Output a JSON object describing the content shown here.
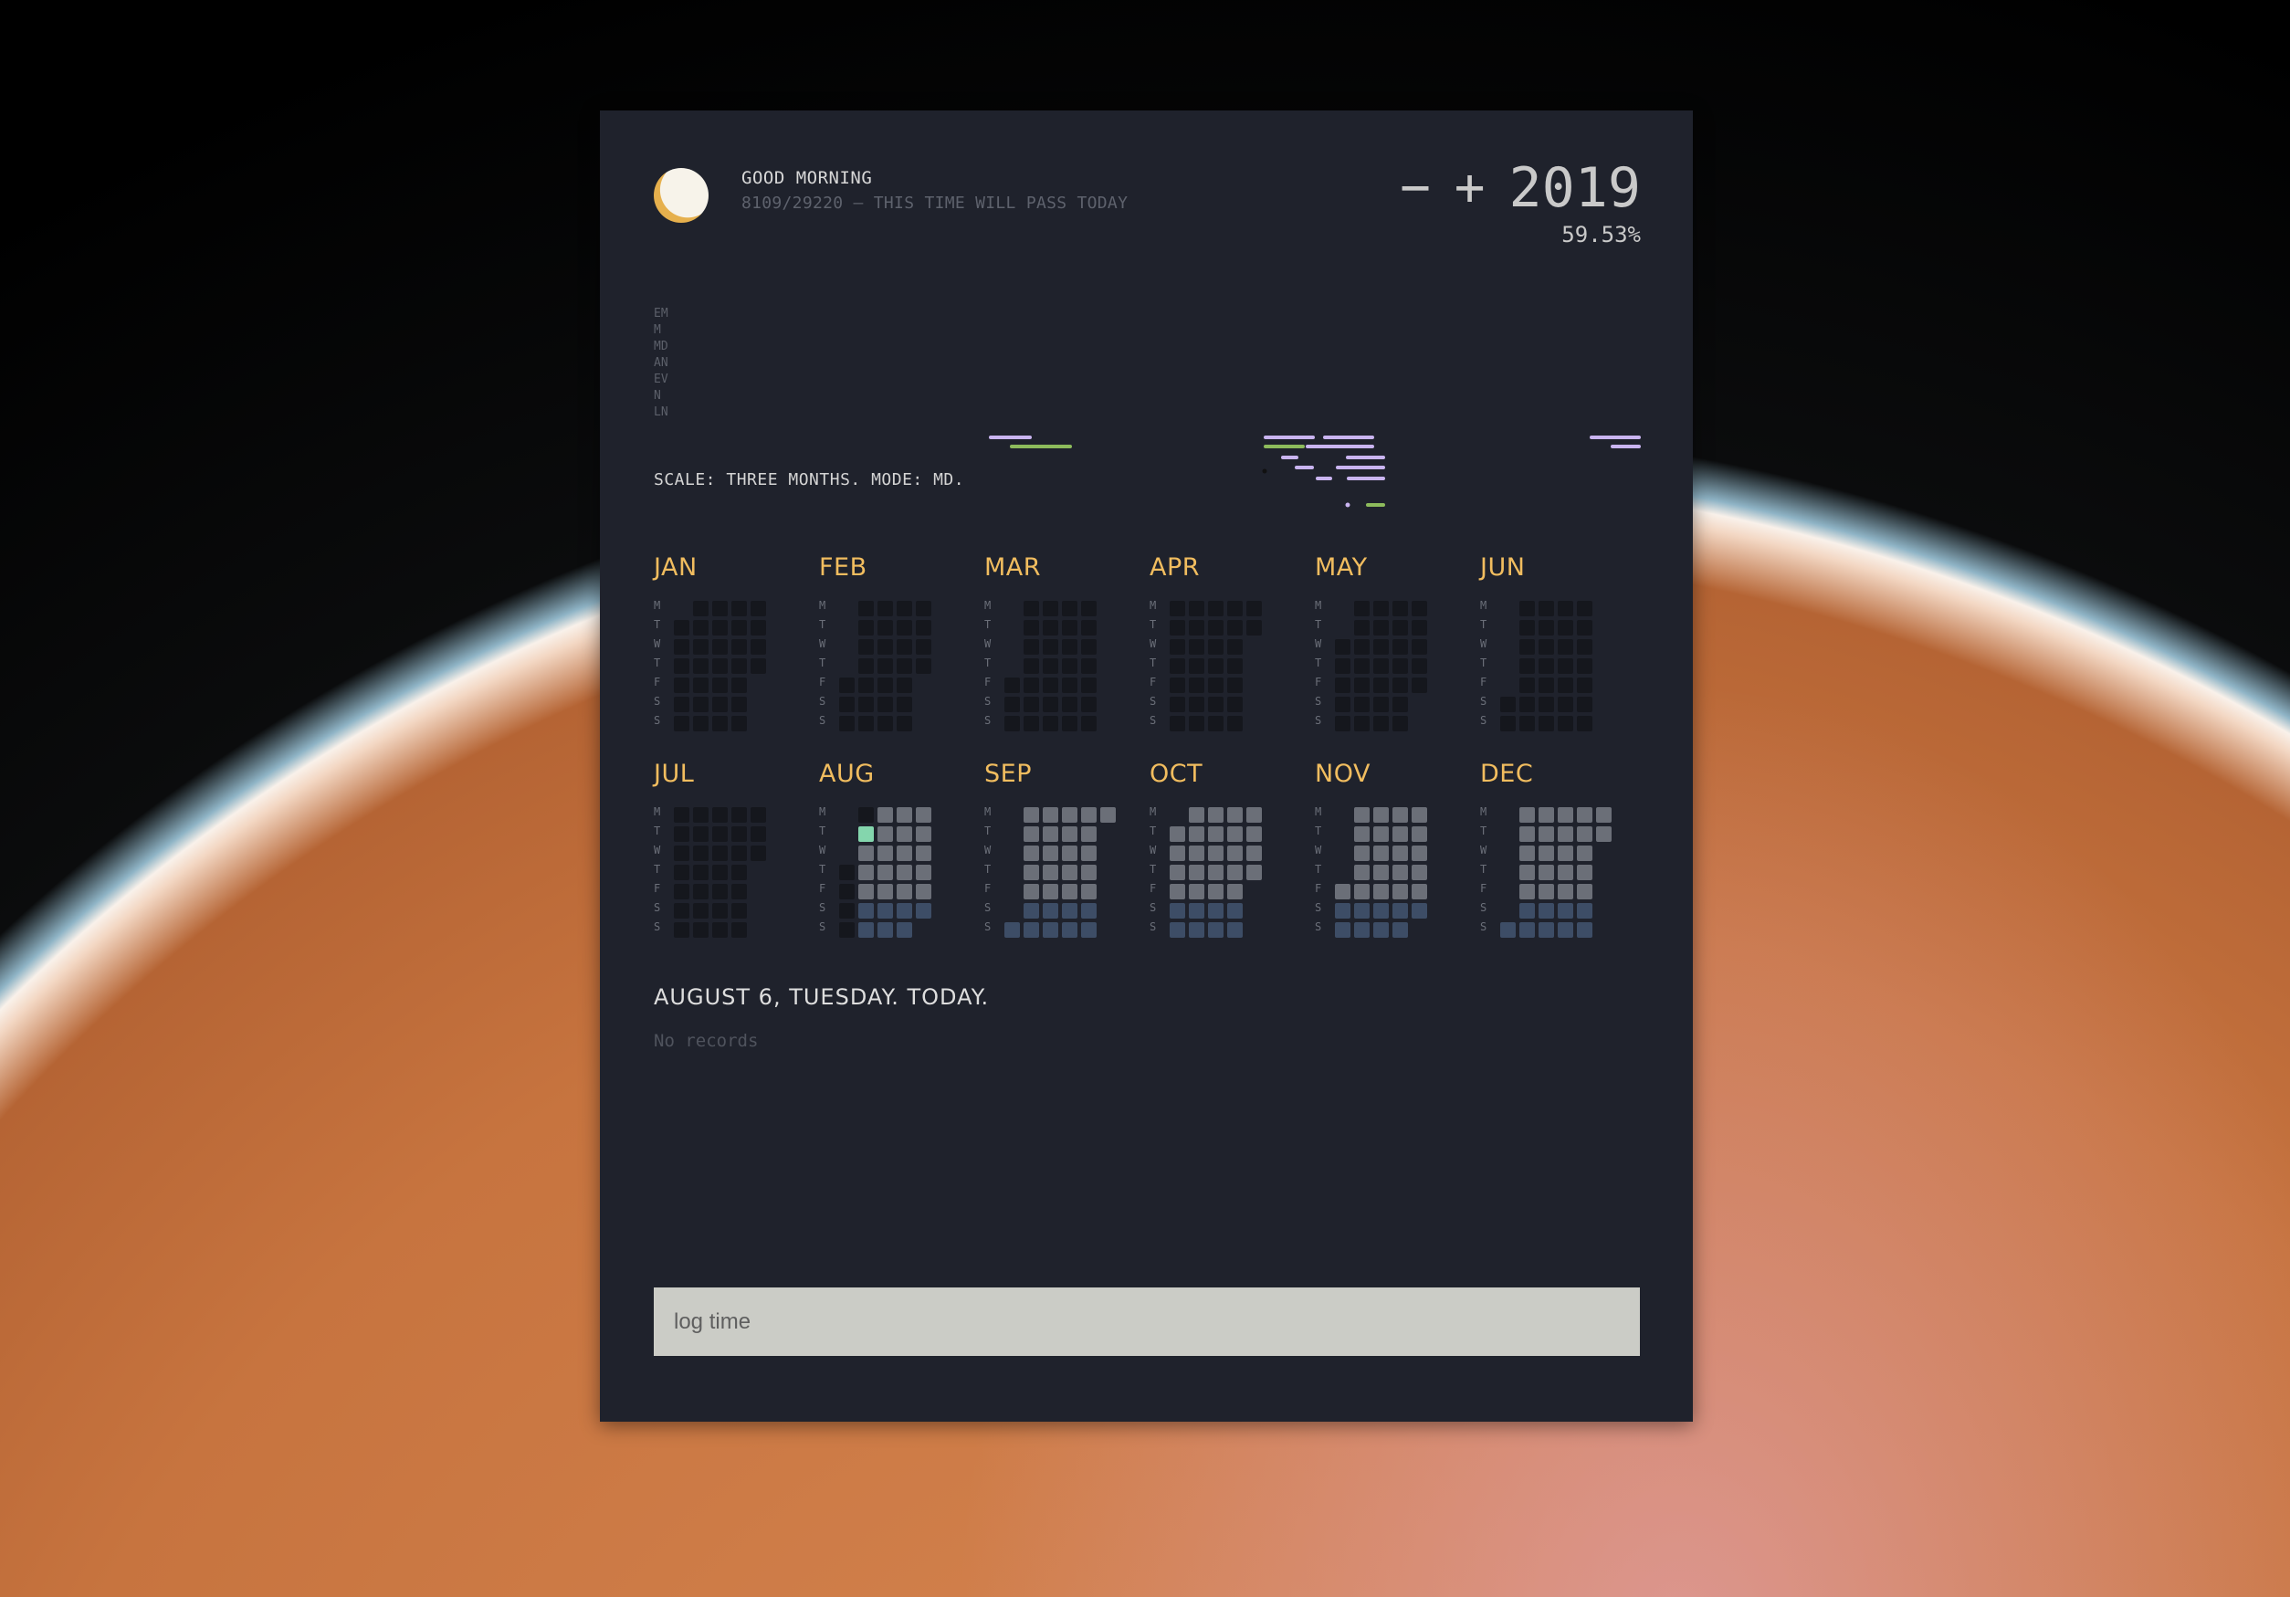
{
  "header": {
    "greeting": "GOOD MORNING",
    "subtitle": "8109/29220 — THIS TIME WILL PASS TODAY",
    "minus": "−",
    "plus": "+",
    "year": "2019",
    "percent": "59.53%"
  },
  "timeline": {
    "labels": [
      "EM",
      "M",
      "MD",
      "AN",
      "EV",
      "N",
      "LN"
    ],
    "colors": {
      "lavender": "#c9b4f0",
      "green": "#8dbb5c"
    }
  },
  "scale_text": "SCALE: THREE MONTHS. MODE: MD.",
  "day_labels": [
    "M",
    "T",
    "W",
    "T",
    "F",
    "S",
    "S"
  ],
  "months": [
    {
      "name": "JAN",
      "start": 1,
      "days": 31,
      "mode": "past"
    },
    {
      "name": "FEB",
      "start": 4,
      "days": 28,
      "mode": "past"
    },
    {
      "name": "MAR",
      "start": 4,
      "days": 31,
      "mode": "past"
    },
    {
      "name": "APR",
      "start": 0,
      "days": 30,
      "mode": "past"
    },
    {
      "name": "MAY",
      "start": 2,
      "days": 31,
      "mode": "past"
    },
    {
      "name": "JUN",
      "start": 5,
      "days": 30,
      "mode": "past"
    },
    {
      "name": "JUL",
      "start": 0,
      "days": 31,
      "mode": "past"
    },
    {
      "name": "AUG",
      "start": 3,
      "days": 31,
      "mode": "current",
      "today": 6
    },
    {
      "name": "SEP",
      "start": 6,
      "days": 30,
      "mode": "future"
    },
    {
      "name": "OCT",
      "start": 1,
      "days": 31,
      "mode": "future"
    },
    {
      "name": "NOV",
      "start": 4,
      "days": 30,
      "mode": "future"
    },
    {
      "name": "DEC",
      "start": 6,
      "days": 31,
      "mode": "future"
    }
  ],
  "cell_colors": {
    "past": "#15171d",
    "future": "#6b6f78",
    "weekend": "#3d4d66",
    "today": "#84d6ad",
    "month_name": "#f1bd5f"
  },
  "today_heading": "AUGUST 6, TUESDAY. TODAY.",
  "records_text": "No records",
  "log_input": {
    "placeholder": "log time",
    "value": ""
  }
}
